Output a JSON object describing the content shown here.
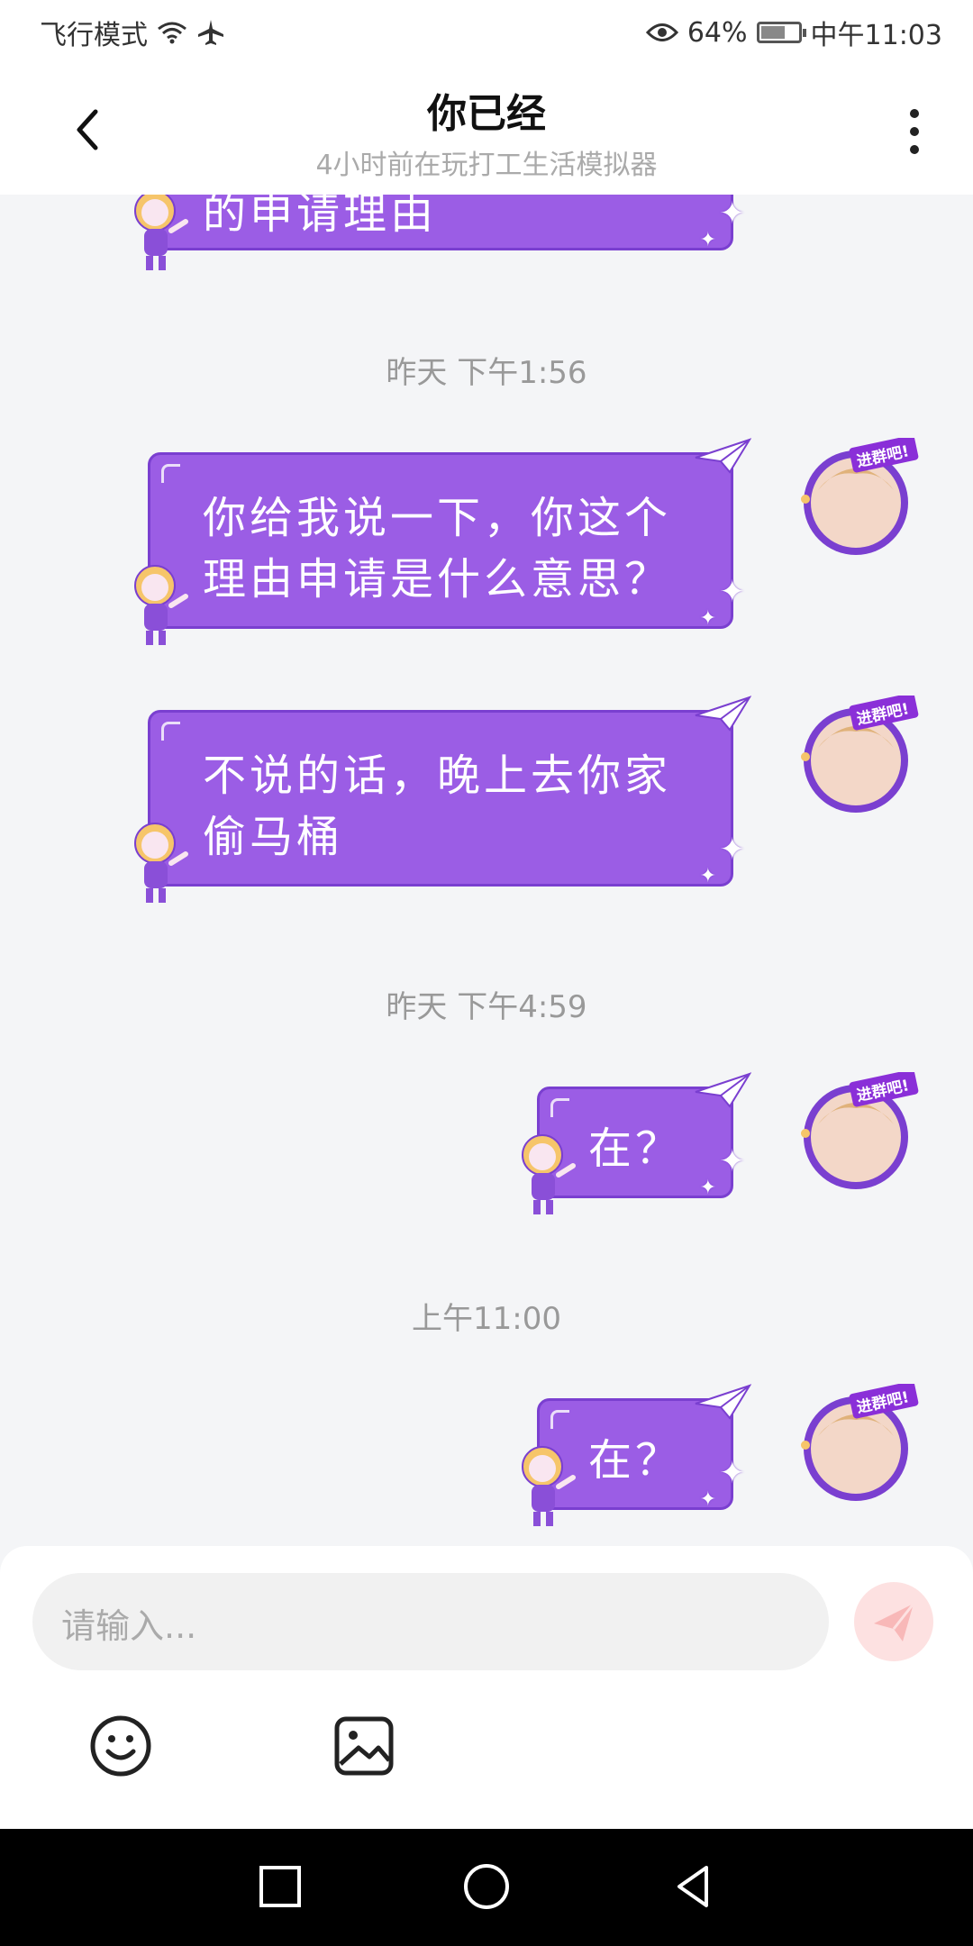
{
  "status_bar": {
    "left_text": "飞行模式",
    "battery": "64%",
    "battery_level": 0.64,
    "time": "中午11:03"
  },
  "header": {
    "title": "你已经",
    "subtitle": "4小时前在玩打工生活模拟器"
  },
  "messages": [
    {
      "text": "的申请理由"
    },
    {
      "timestamp": "昨天 下午1:56"
    },
    {
      "text_line1": "你给我说一下，你这个",
      "text_line2": "理由申请是什么意思？"
    },
    {
      "text_line1": "不说的话，晚上去你家",
      "text_line2": "偷马桶"
    },
    {
      "timestamp": "昨天 下午4:59"
    },
    {
      "text": "在？"
    },
    {
      "timestamp": "上午11:00"
    },
    {
      "text": "在？"
    }
  ],
  "avatar_badge": "进群吧!",
  "input": {
    "placeholder": "请输入..."
  },
  "colors": {
    "bubble": "#9b5de5",
    "bubble_border": "#7a3fd0",
    "send_disabled": "#fde1e1"
  }
}
